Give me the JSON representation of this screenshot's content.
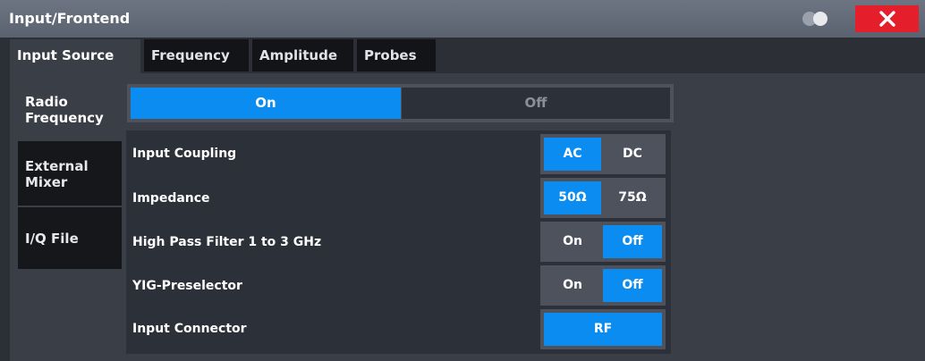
{
  "window": {
    "title": "Input/Frontend"
  },
  "tabs": [
    "Input Source",
    "Frequency",
    "Amplitude",
    "Probes"
  ],
  "sidebar": {
    "items": [
      {
        "line1": "Radio",
        "line2": "Frequency"
      },
      {
        "line1": "External",
        "line2": "Mixer"
      },
      {
        "line1": "I/Q File",
        "line2": ""
      }
    ]
  },
  "main_toggle": {
    "on": "On",
    "off": "Off",
    "selected": "On"
  },
  "settings": {
    "input_coupling": {
      "label": "Input Coupling",
      "opt1": "AC",
      "opt2": "DC",
      "selected": "AC"
    },
    "impedance": {
      "label": "Impedance",
      "opt1": "50Ω",
      "opt2": "75Ω",
      "selected": "50Ω"
    },
    "high_pass": {
      "label": "High Pass Filter 1 to 3 GHz",
      "opt1": "On",
      "opt2": "Off",
      "selected": "Off"
    },
    "yig": {
      "label": "YIG-Preselector",
      "opt1": "On",
      "opt2": "Off",
      "selected": "Off"
    },
    "connector": {
      "label": "Input Connector",
      "value": "RF"
    }
  },
  "colors": {
    "accent": "#0a8cf0",
    "close": "#e41e2b",
    "titlebar": "#5f6775"
  }
}
